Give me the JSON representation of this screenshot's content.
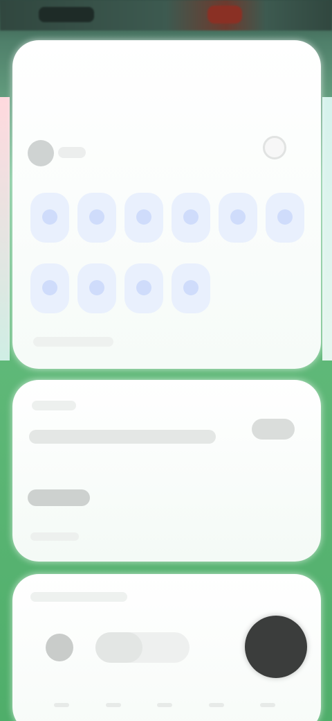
{
  "colors": {
    "background_green": "#5fb878",
    "card_background": "#ffffff",
    "tile_blue": "#e9f0fd",
    "action_button_dark": "#3b3d3c"
  },
  "status_bar": {
    "clock": "",
    "indicators": ""
  },
  "card_apps": {
    "avatar_label": "",
    "settings_icon": "gear-icon",
    "tiles": [
      {
        "label": ""
      },
      {
        "label": ""
      },
      {
        "label": ""
      },
      {
        "label": ""
      },
      {
        "label": ""
      },
      {
        "label": ""
      },
      {
        "label": ""
      },
      {
        "label": ""
      },
      {
        "label": ""
      },
      {
        "label": ""
      }
    ],
    "footer": ""
  },
  "card_info": {
    "label": "",
    "headline": "",
    "value": "",
    "note": ""
  },
  "card_media": {
    "label": "",
    "progress_fraction": 0.5,
    "play_icon": "circle-button",
    "page_dots": 5
  }
}
